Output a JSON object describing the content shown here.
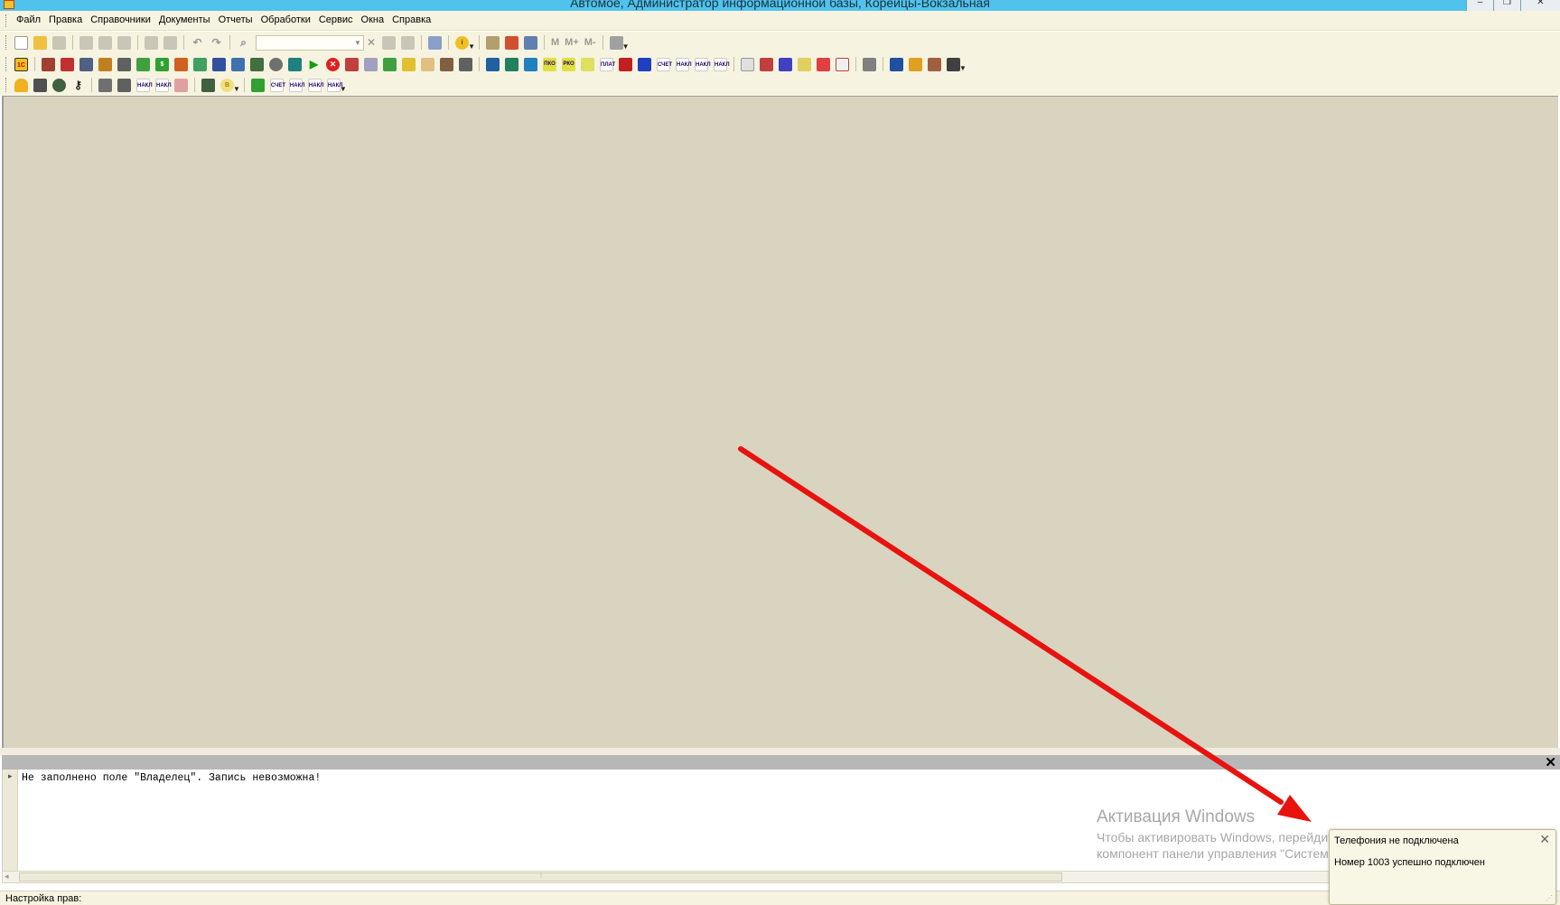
{
  "window": {
    "title": "Автомое, Администратор информационной базы, Корейцы-Вокзальная",
    "minimize": "–",
    "restore": "❐",
    "close": "✕"
  },
  "menu": {
    "items": [
      "Файл",
      "Правка",
      "Справочники",
      "Документы",
      "Отчеты",
      "Обработки",
      "Сервис",
      "Окна",
      "Справка"
    ]
  },
  "toolbar1": {
    "memory_labels": [
      "M",
      "M+",
      "M-"
    ]
  },
  "toolbar2": {
    "badge_labels": [
      "ПКО",
      "РКО",
      "ПЛАТ",
      "СЧЕТ",
      "НАКЛ",
      "НАКЛ",
      "НАКЛ"
    ]
  },
  "toolbar3": {
    "badge_labels": [
      "НАКЛ",
      "НАКЛ",
      "СЧЕТ",
      "НАКЛ",
      "НАКЛ",
      "НАКЛ"
    ]
  },
  "messages": {
    "lines": [
      "Не заполнено поле \"Владелец\". Запись невозможна!"
    ],
    "close": "✕"
  },
  "watermark": {
    "title": "Активация Windows",
    "subtitle": "Чтобы активировать Windows, перейдите в компонент панели управления \"Система\"."
  },
  "status": {
    "text": "Настройка прав:"
  },
  "popup": {
    "title": "Телефония не подключена",
    "message": "Номер 1003 успешно подключен",
    "close": "✕"
  },
  "colors": {
    "arrow": "#e8120f",
    "workspace": "#d9d4bf",
    "titlebar": "#4fc3ec"
  }
}
